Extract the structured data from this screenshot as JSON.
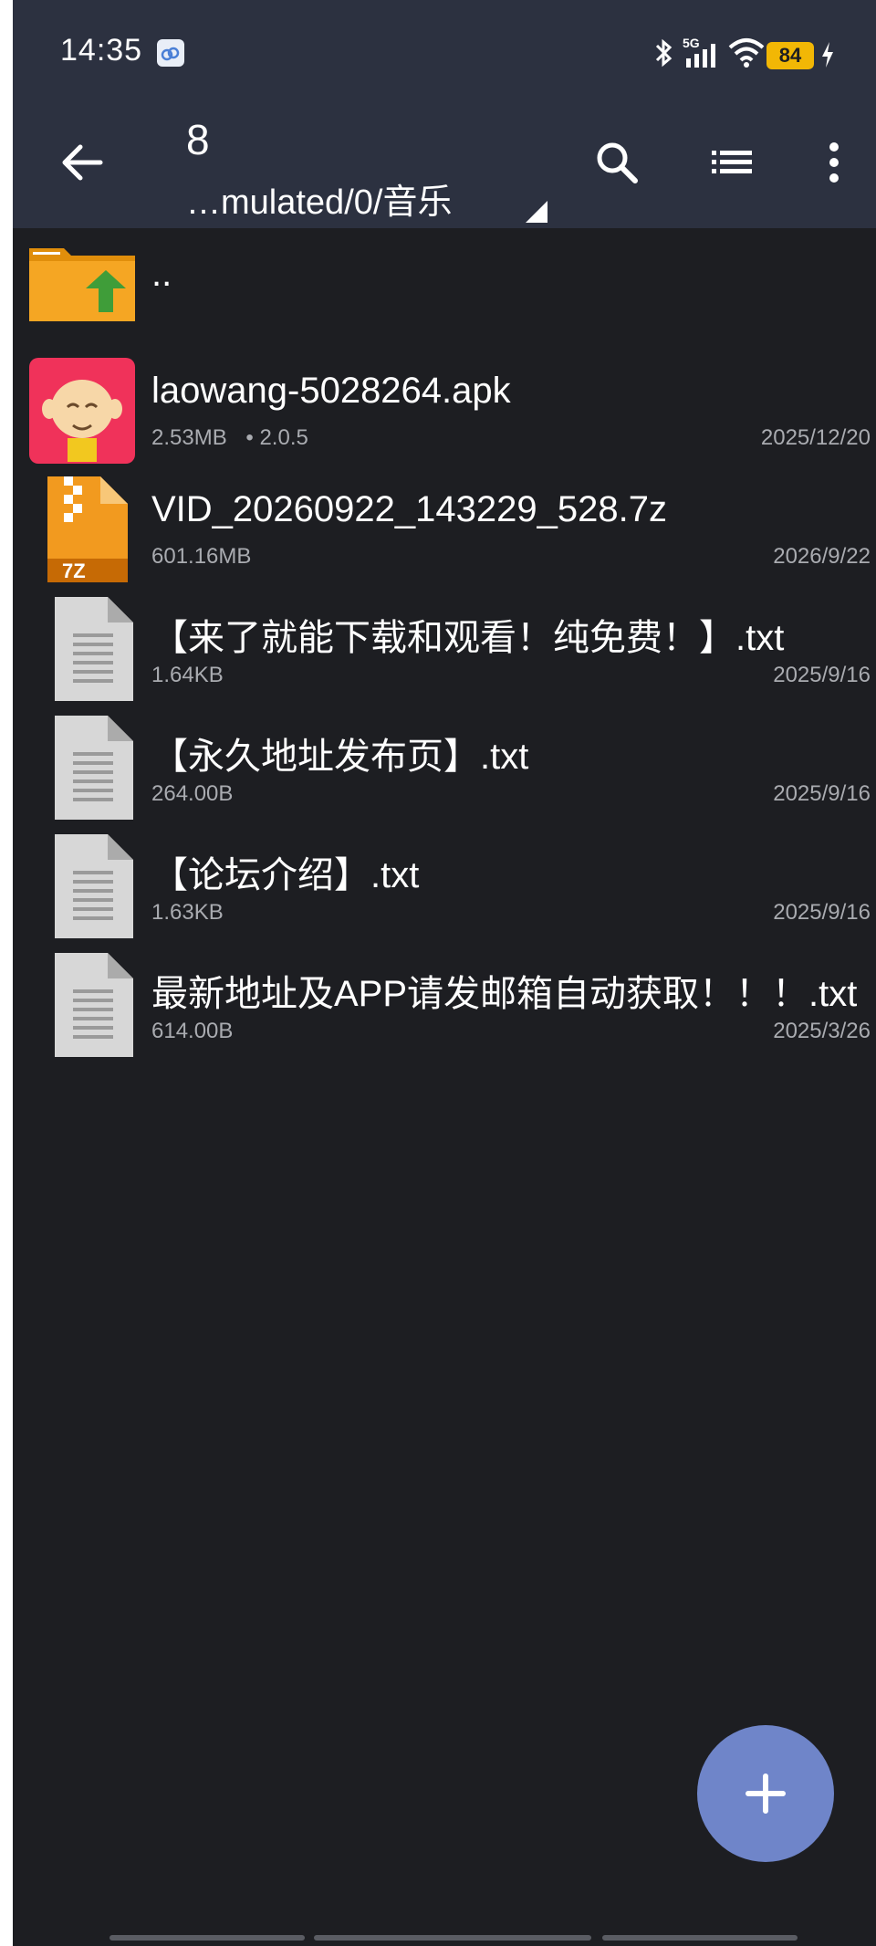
{
  "status_bar": {
    "time": "14:35",
    "battery": "84",
    "icons": [
      "cloud-icon",
      "bluetooth-icon",
      "signal-5g-icon",
      "wifi-icon",
      "charging-icon"
    ]
  },
  "toolbar": {
    "count": "8",
    "path": "…mulated/0/音乐",
    "icons": [
      "back-arrow-icon",
      "search-icon",
      "list-view-icon",
      "more-vert-icon"
    ]
  },
  "parent_entry": {
    "label": ".."
  },
  "files": [
    {
      "name": "laowang-5028264.apk",
      "size": "2.53MB",
      "extra": "• 2.0.5",
      "date": "2025/12/20",
      "icon": "apk-app-icon"
    },
    {
      "name": "VID_20260922_143229_528.7z",
      "size": "601.16MB",
      "extra": "",
      "date": "2026/9/22",
      "icon": "7z-archive-icon"
    },
    {
      "name": "【来了就能下载和观看！纯免费！】.txt",
      "size": "1.64KB",
      "extra": "",
      "date": "2025/9/16",
      "icon": "text-file-icon"
    },
    {
      "name": "【永久地址发布页】.txt",
      "size": "264.00B",
      "extra": "",
      "date": "2025/9/16",
      "icon": "text-file-icon"
    },
    {
      "name": "【论坛介绍】.txt",
      "size": "1.63KB",
      "extra": "",
      "date": "2025/9/16",
      "icon": "text-file-icon"
    },
    {
      "name": "最新地址及APP请发邮箱自动获取！！！.txt",
      "size": "614.00B",
      "extra": "",
      "date": "2025/3/26",
      "icon": "text-file-icon"
    }
  ],
  "fab": {
    "icon": "plus-icon"
  },
  "colors": {
    "toolbar_bg": "#2c3140",
    "list_bg": "#1d1e22",
    "fab": "#6f85c9",
    "battery": "#f2b705",
    "folder": "#f5a623",
    "arrow_up": "#3f9d39"
  }
}
